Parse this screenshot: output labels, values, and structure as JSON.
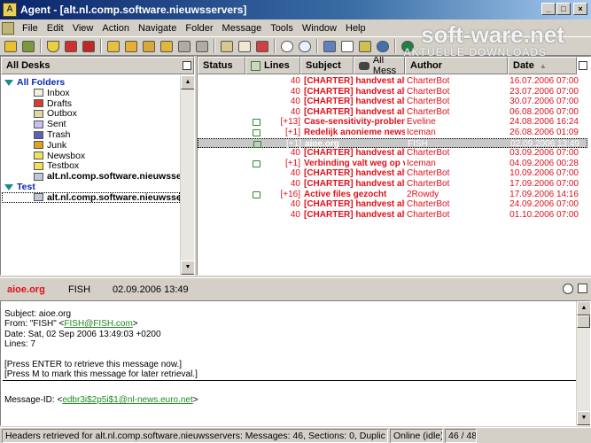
{
  "window": {
    "title": "Agent - [alt.nl.comp.software.nieuwsservers]",
    "minimize": "_",
    "maximize": "□",
    "close": "×"
  },
  "menu": [
    "File",
    "Edit",
    "View",
    "Action",
    "Navigate",
    "Folder",
    "Message",
    "Tools",
    "Window",
    "Help"
  ],
  "watermark": {
    "main": "soft-ware.net",
    "sub": "AKTUELLE DOWNLOADS"
  },
  "folders": {
    "header": "All Desks",
    "items": [
      {
        "label": "All Folders",
        "icon": "desk-icon",
        "level": 0,
        "bold": true
      },
      {
        "label": "Inbox",
        "icon": "inbox-icon",
        "level": 1
      },
      {
        "label": "Drafts",
        "icon": "drafts-icon",
        "level": 1
      },
      {
        "label": "Outbox",
        "icon": "outbox-icon",
        "level": 1
      },
      {
        "label": "Sent",
        "icon": "sent-icon",
        "level": 1
      },
      {
        "label": "Trash",
        "icon": "trash-icon",
        "level": 1
      },
      {
        "label": "Junk",
        "icon": "junk-icon",
        "level": 1
      },
      {
        "label": "Newsbox",
        "icon": "folder-icon",
        "level": 1
      },
      {
        "label": "Testbox",
        "icon": "folder-icon",
        "level": 1
      },
      {
        "label": "alt.nl.comp.software.nieuwsserv",
        "icon": "newsgroup-icon",
        "level": 1,
        "bold": true
      },
      {
        "label": "Test",
        "icon": "desk-icon",
        "level": 0,
        "bold": true
      },
      {
        "label": "alt.nl.comp.software.nieuwsserv",
        "icon": "newsgroup-icon",
        "level": 1,
        "bold": true,
        "selected": true
      }
    ]
  },
  "list": {
    "columns": [
      "Status",
      "Lines",
      "Subject",
      "All Mess",
      "Author",
      "Date"
    ],
    "rows": [
      {
        "lines": "40",
        "subject": "[CHARTER] handvest alt",
        "author": "CharterBot",
        "date": "16.07.2006 07:00",
        "thread": false
      },
      {
        "lines": "40",
        "subject": "[CHARTER] handvest alt",
        "author": "CharterBot",
        "date": "23.07.2006 07:00",
        "thread": false
      },
      {
        "lines": "40",
        "subject": "[CHARTER] handvest alt",
        "author": "CharterBot",
        "date": "30.07.2006 07:00",
        "thread": false
      },
      {
        "lines": "40",
        "subject": "[CHARTER] handvest alt",
        "author": "CharterBot",
        "date": "06.08.2006 07:00",
        "thread": false
      },
      {
        "lines": "[+13]",
        "subject": "Case-sensitivity-probler",
        "author": "Eveline",
        "date": "24.08.2006 16:24",
        "thread": true
      },
      {
        "lines": "[+1]",
        "subject": "Redelijk anonieme news",
        "author": "Iceman",
        "date": "26.08.2006 01:09",
        "thread": true
      },
      {
        "lines": "[+1]",
        "subject": "aioe.org",
        "author": "FISH",
        "date": "02.09.2006 13:49",
        "thread": true,
        "selected": true
      },
      {
        "lines": "40",
        "subject": "[CHARTER] handvest alt",
        "author": "CharterBot",
        "date": "03.09.2006 07:00",
        "thread": false
      },
      {
        "lines": "[+1]",
        "subject": "Verbinding valt weg op v",
        "author": "Iceman",
        "date": "04.09.2006 00:28",
        "thread": true
      },
      {
        "lines": "40",
        "subject": "[CHARTER] handvest alt",
        "author": "CharterBot",
        "date": "10.09.2006 07:00",
        "thread": false
      },
      {
        "lines": "40",
        "subject": "[CHARTER] handvest alt",
        "author": "CharterBot",
        "date": "17.09.2006 07:00",
        "thread": false
      },
      {
        "lines": "[+16]",
        "subject": "Active files gezocht",
        "author": "2Rowdy",
        "date": "17.09.2006 14:16",
        "thread": true
      },
      {
        "lines": "40",
        "subject": "[CHARTER] handvest alt",
        "author": "CharterBot",
        "date": "24.09.2006 07:00",
        "thread": false
      },
      {
        "lines": "40",
        "subject": "[CHARTER] handvest alt",
        "author": "CharterBot",
        "date": "01.10.2006 07:00",
        "thread": false
      }
    ]
  },
  "preview": {
    "subject": "aioe.org",
    "author": "FISH",
    "date": "02.09.2006 13:49",
    "lines": [
      {
        "text": "Subject: aioe.org"
      },
      {
        "pre": "From: \"FISH\" <",
        "link": "FISH@FISH.com",
        "post": ">"
      },
      {
        "text": "Date: Sat, 02 Sep 2006 13:49:03 +0200"
      },
      {
        "text": "Lines: 7"
      },
      {
        "text": ""
      },
      {
        "text": "[Press ENTER to retrieve this message now.]"
      },
      {
        "text": "[Press M to mark this message for later retrieval.]"
      },
      {
        "text": ""
      },
      {
        "pre": "Message-ID: <",
        "link": "edbr3i$2p5i$1@nl-news.euro.net",
        "post": ">"
      }
    ]
  },
  "status": {
    "message": "Headers retrieved for alt.nl.comp.software.nieuwsservers: Messages: 46, Sections: 0, Duplic",
    "online": "Online (idle)",
    "count": "46 / 48"
  },
  "colors": {
    "unread": "#e0101a",
    "title_active": "#0a246a",
    "link": "#1e8a1e"
  }
}
